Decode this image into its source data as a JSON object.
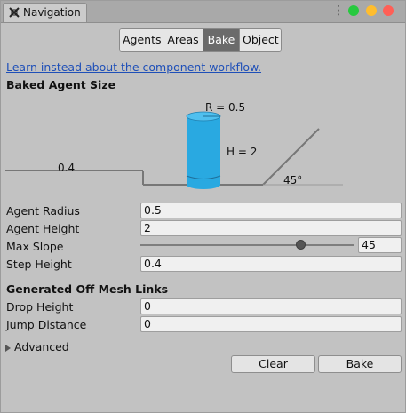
{
  "window": {
    "tab_title": "Navigation",
    "traffic_lights": {
      "green": "#27c93f",
      "yellow": "#ffbd2e",
      "red": "#ff5f56"
    }
  },
  "toolbar": {
    "tabs": [
      {
        "label": "Agents",
        "active": false
      },
      {
        "label": "Areas",
        "active": false
      },
      {
        "label": "Bake",
        "active": true
      },
      {
        "label": "Object",
        "active": false
      }
    ]
  },
  "link_text": "Learn instead about the component workflow.",
  "baked_agent_size": {
    "header": "Baked Agent Size",
    "radius_label": "R = 0.5",
    "height_label": "H = 2",
    "step_label": "0.4",
    "slope_label": "45°",
    "agent_color": "#29a9e1"
  },
  "fields": {
    "agent_radius": {
      "label": "Agent Radius",
      "value": "0.5"
    },
    "agent_height": {
      "label": "Agent Height",
      "value": "2"
    },
    "max_slope": {
      "label": "Max Slope",
      "value": "45",
      "slider_fraction": 0.75
    },
    "step_height": {
      "label": "Step Height",
      "value": "0.4"
    }
  },
  "off_mesh": {
    "header": "Generated Off Mesh Links",
    "drop_height": {
      "label": "Drop Height",
      "value": "0"
    },
    "jump_distance": {
      "label": "Jump Distance",
      "value": "0"
    }
  },
  "advanced_label": "Advanced",
  "buttons": {
    "clear": "Clear",
    "bake": "Bake"
  }
}
